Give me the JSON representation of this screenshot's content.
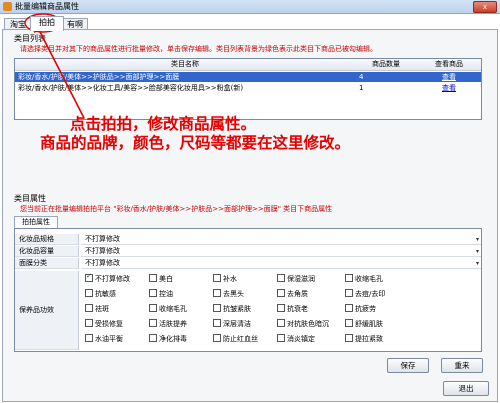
{
  "window": {
    "title": "批量编辑商品属性",
    "close_label": "x"
  },
  "tabs": [
    {
      "label": "淘宝"
    },
    {
      "label": "拍拍"
    },
    {
      "label": "有啊"
    }
  ],
  "category_group": {
    "title": "类目列表",
    "hint": "请选择类目并对其下的商品属性进行批量修改，单击保存编辑。类目列表背景为绿色表示此类目下商品已被勾编辑。",
    "columns": [
      "类目名称",
      "商品数量",
      "查看商品"
    ],
    "rows": [
      {
        "name": "彩妆/香水/护肤/美体>>护肤品>>面部护理>>面膜",
        "count": "4",
        "link": "查看",
        "selected": true
      },
      {
        "name": "彩妆/香水/护肤/美体>>化妆工具/美容>>脸部美容化妆用具>>粉盒(新)",
        "count": "1",
        "link": "查看",
        "selected": false
      }
    ]
  },
  "annotation": {
    "line1": "点击拍拍，修改商品属性。",
    "line2": "商品的品牌，颜色，尺码等都要在这里修改。"
  },
  "property_group": {
    "title": "类目属性",
    "hint": "您当前正在批量编辑拍拍平台 \"彩妆/香水/护肤/美体>>护肤品>>面部护理>>面膜\" 类目下商品属性",
    "tab_label": "拍拍属性",
    "fields": [
      {
        "label": "化妆品规格",
        "value": "不打算修改"
      },
      {
        "label": "化妆品容量",
        "value": "不打算修改"
      },
      {
        "label": "面膜分类",
        "value": "不打算修改"
      }
    ],
    "effects_label": "保养品功效",
    "effects": [
      {
        "label": "不打算修改",
        "checked": true
      },
      {
        "label": "美白",
        "checked": false
      },
      {
        "label": "补水",
        "checked": false
      },
      {
        "label": "保湿滋润",
        "checked": false
      },
      {
        "label": "收缩毛孔",
        "checked": false
      },
      {
        "label": "抗敏感",
        "checked": false
      },
      {
        "label": "控油",
        "checked": false
      },
      {
        "label": "去黑头",
        "checked": false
      },
      {
        "label": "去角质",
        "checked": false
      },
      {
        "label": "去痘/去印",
        "checked": false
      },
      {
        "label": "祛斑",
        "checked": false
      },
      {
        "label": "收缩毛孔",
        "checked": false
      },
      {
        "label": "抗皱紧肤",
        "checked": false
      },
      {
        "label": "抗衰老",
        "checked": false
      },
      {
        "label": "抗疲劳",
        "checked": false
      },
      {
        "label": "受损修复",
        "checked": false
      },
      {
        "label": "活肤提养",
        "checked": false
      },
      {
        "label": "深层清洁",
        "checked": false
      },
      {
        "label": "对抗肤色暗沉",
        "checked": false
      },
      {
        "label": "舒缓肌肤",
        "checked": false
      },
      {
        "label": "水油平衡",
        "checked": false
      },
      {
        "label": "净化排毒",
        "checked": false
      },
      {
        "label": "防止红血丝",
        "checked": false
      },
      {
        "label": "消炎镇定",
        "checked": false
      },
      {
        "label": "提拉紧致",
        "checked": false
      }
    ]
  },
  "buttons": {
    "save": "保存",
    "reset": "重来",
    "exit": "退出"
  },
  "colors": {
    "annotation": "#e60000",
    "hint": "#cc0000",
    "selection": "#3366cc"
  }
}
